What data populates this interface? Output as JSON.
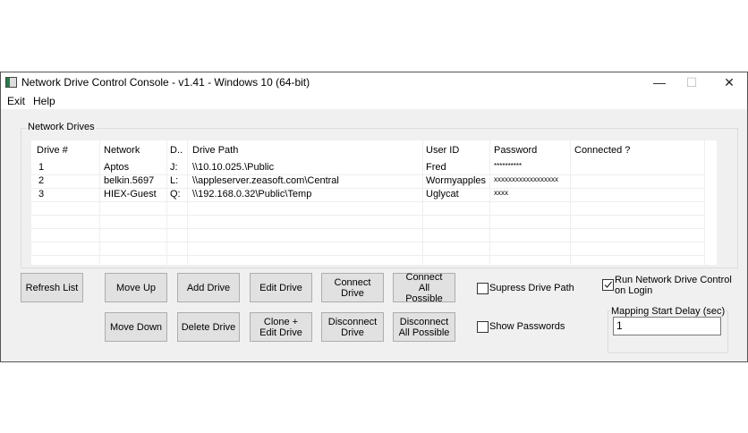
{
  "window": {
    "title": "Network Drive Control Console - v1.41 - Windows 10  (64-bit)",
    "minimize": "—",
    "maximize": "☐",
    "close": "✕"
  },
  "menu": [
    "Exit",
    "Help"
  ],
  "group_label": "Network Drives",
  "table": {
    "headers": [
      "Drive #",
      "Network",
      "D..",
      "Drive Path",
      "User ID",
      "Password",
      "Connected ?"
    ],
    "rows": [
      [
        "1",
        "Aptos",
        "J:",
        "\\\\10.10.025.\\Public",
        "Fred",
        "**********",
        ""
      ],
      [
        "2",
        "belkin.5697",
        "L:",
        "\\\\appleserver.zeasoft.com\\Central",
        "Wormyapples",
        "xxxxxxxxxxxxxxxxxx",
        ""
      ],
      [
        "3",
        "HIEX-Guest",
        "Q:",
        "\\\\192.168.0.32\\Public\\Temp",
        "Uglycat",
        "xxxx",
        ""
      ]
    ]
  },
  "buttons": {
    "refresh": "Refresh List",
    "move_up": "Move Up",
    "move_down": "Move Down",
    "add": "Add Drive",
    "delete": "Delete Drive",
    "edit": "Edit Drive",
    "clone": "Clone + Edit Drive",
    "connect": "Connect Drive",
    "disconnect": "Disconnect Drive",
    "connect_all": "Connect All Possible",
    "disconnect_all": "Disconnect All Possible"
  },
  "options": {
    "suppress_path": {
      "label": "Supress Drive Path",
      "checked": false
    },
    "show_passwords": {
      "label": "Show Passwords",
      "checked": false
    },
    "run_on_login": {
      "label": "Run Network Drive Control on Login",
      "checked": true
    },
    "delay_label": "Mapping Start Delay (sec)",
    "delay_value": "1"
  }
}
